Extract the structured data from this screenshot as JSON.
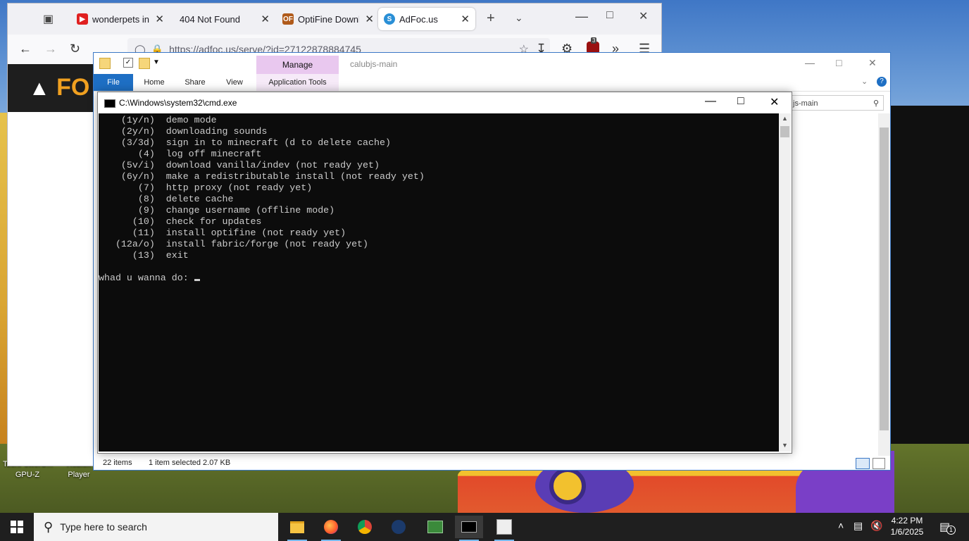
{
  "browser": {
    "tabs": [
      {
        "label": "wonderpets in th",
        "icon": "youtube-icon"
      },
      {
        "label": "404 Not Found",
        "icon": "none"
      },
      {
        "label": "OptiFine Downl",
        "icon": "optifine-icon"
      },
      {
        "label": "AdFoc.us",
        "icon": "adfocus-icon"
      }
    ],
    "url": "https://adfoc.us/serve/?id=27122878884745",
    "extension_badge": "3",
    "page_logo": "FO"
  },
  "explorer": {
    "manage_label": "Manage",
    "folder_title": "calubjs-main",
    "ribbon_tabs": [
      "File",
      "Home",
      "Share",
      "View",
      "Application Tools"
    ],
    "search_text": "js-main",
    "status_items": "22 items",
    "status_selected": "1 item selected  2.07 KB"
  },
  "cmd": {
    "title": "C:\\Windows\\system32\\cmd.exe",
    "lines": [
      "    (1y/n)  demo mode",
      "    (2y/n)  downloading sounds",
      "    (3/3d)  sign in to minecraft (d to delete cache)",
      "       (4)  log off minecraft",
      "    (5v/i)  download vanilla/indev (not ready yet)",
      "    (6y/n)  make a redistributable install (not ready yet)",
      "       (7)  http proxy (not ready yet)",
      "       (8)  delete cache",
      "       (9)  change username (offline mode)",
      "      (10)  check for updates",
      "      (11)  install optifine (not ready yet)",
      "   (12a/o)  install fabric/forge (not ready yet)",
      "      (13)  exit",
      "",
      "whad u wanna do: "
    ]
  },
  "desktop": {
    "icons": [
      {
        "label": "TechPowerU... GPU-Z"
      },
      {
        "label": "Roblox Player"
      }
    ]
  },
  "taskbar": {
    "search_placeholder": "Type here to search",
    "time": "4:22 PM",
    "date": "1/6/2025",
    "notification_count": "1"
  },
  "colors": {
    "cmd_bg": "#0c0c0c",
    "cmd_fg": "#cccccc",
    "explorer_file_tab": "#1e6fc4",
    "manage_tab": "#e9c8ef",
    "taskbar_bg": "#1f1f1f"
  }
}
